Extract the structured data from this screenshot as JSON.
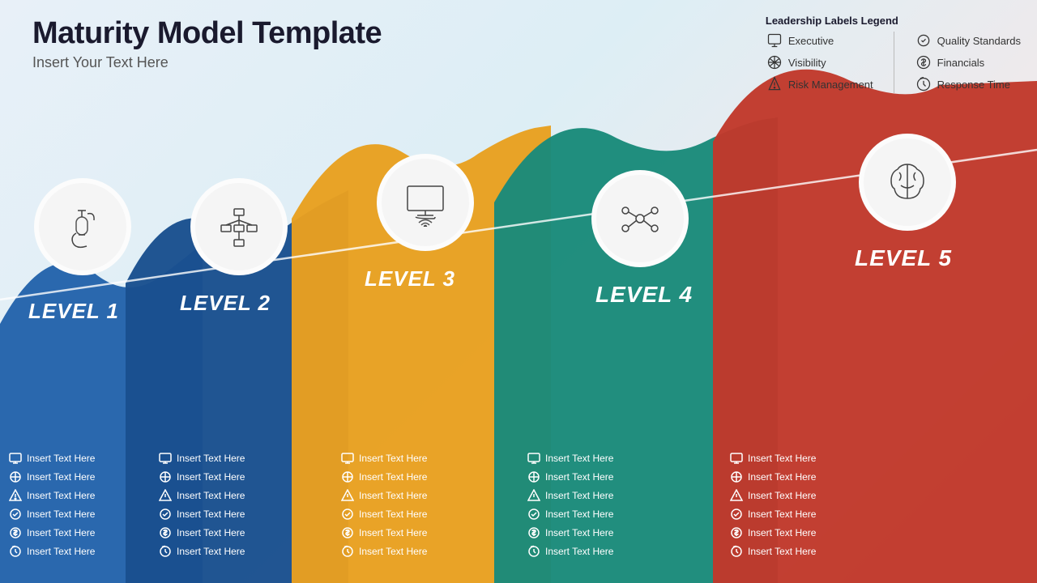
{
  "header": {
    "title": "Maturity Model Template",
    "subtitle": "Insert Your Text Here"
  },
  "legend": {
    "title": "Leadership Labels Legend",
    "left_col": [
      {
        "label": "Executive",
        "icon": "executive"
      },
      {
        "label": "Visibility",
        "icon": "visibility"
      },
      {
        "label": "Risk Management",
        "icon": "risk"
      }
    ],
    "right_col": [
      {
        "label": "Quality Standards",
        "icon": "quality"
      },
      {
        "label": "Financials",
        "icon": "financials"
      },
      {
        "label": "Response Time",
        "icon": "response"
      }
    ]
  },
  "levels": [
    {
      "id": 1,
      "label": "LEVEL 1",
      "items": [
        "Insert Text Here",
        "Insert Text Here",
        "Insert Text Here",
        "Insert Text Here",
        "Insert Text Here",
        "Insert Text Here"
      ]
    },
    {
      "id": 2,
      "label": "LEVEL 2",
      "items": [
        "Insert Text Here",
        "Insert Text Here",
        "Insert Text Here",
        "Insert Text Here",
        "Insert Text Here",
        "Insert Text Here"
      ]
    },
    {
      "id": 3,
      "label": "LEVEL 3",
      "items": [
        "Insert Text Here",
        "Insert Text Here",
        "Insert Text Here",
        "Insert Text Here",
        "Insert Text Here",
        "Insert Text Here"
      ]
    },
    {
      "id": 4,
      "label": "LEVEL 4",
      "items": [
        "Insert Text Here",
        "Insert Text Here",
        "Insert Text Here",
        "Insert Text Here",
        "Insert Text Here",
        "Insert Text Here"
      ]
    },
    {
      "id": 5,
      "label": "LEVEL 5",
      "items": [
        "Insert Text Here",
        "Insert Text Here",
        "Insert Text Here",
        "Insert Text Here",
        "Insert Text Here",
        "Insert Text Here"
      ]
    }
  ]
}
